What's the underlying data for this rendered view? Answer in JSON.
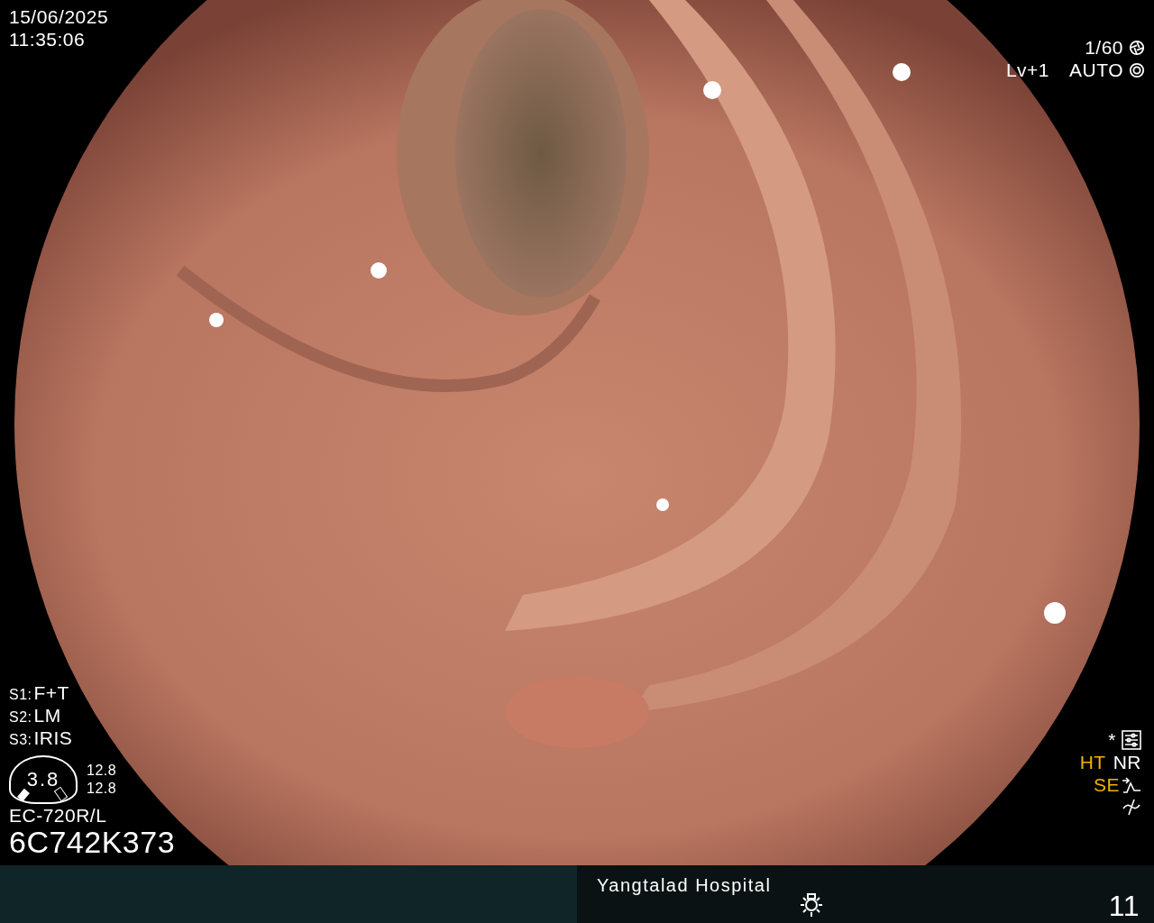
{
  "datetime": {
    "date": "15/06/2025",
    "time": "11:35:06"
  },
  "exposure": {
    "shutter": "1/60",
    "lv": "Lv+1",
    "mode": "AUTO"
  },
  "switches": [
    {
      "label": "S1:",
      "value": "F+T"
    },
    {
      "label": "S2:",
      "value": "LM"
    },
    {
      "label": "S3:",
      "value": "IRIS"
    }
  ],
  "scope": {
    "gauge": "3.8",
    "readings": [
      "12.8",
      "12.8"
    ],
    "model": "EC-720R/L",
    "serial": "6C742K373"
  },
  "indicators": {
    "star": "*",
    "modes": [
      {
        "text": "HT",
        "color": "#f0b400"
      },
      {
        "text": "NR",
        "color": "#ffffff"
      }
    ],
    "enhance": {
      "text": "SE",
      "color": "#f0b400"
    }
  },
  "footer": {
    "hospital": "Yangtalad Hospital",
    "number": "11"
  }
}
